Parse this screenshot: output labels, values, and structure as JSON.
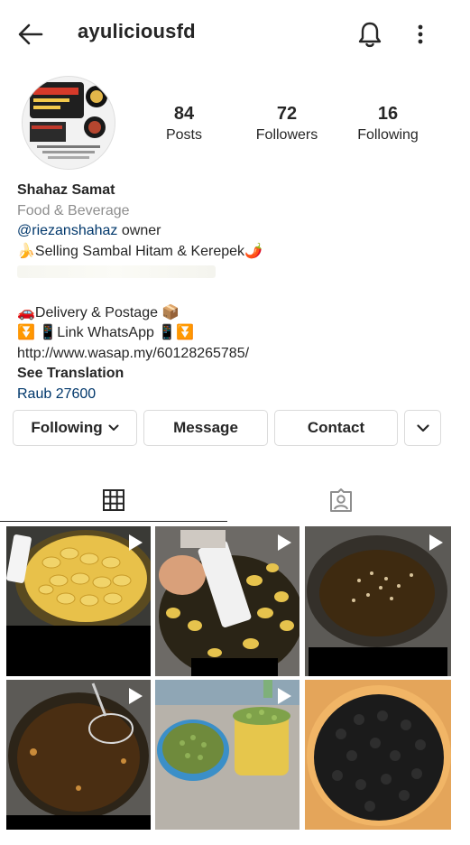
{
  "header": {
    "username": "ayuliciousfd"
  },
  "stats": [
    {
      "value": "84",
      "label": "Posts"
    },
    {
      "value": "72",
      "label": "Followers"
    },
    {
      "value": "16",
      "label": "Following"
    }
  ],
  "bio": {
    "name": "Shahaz Samat",
    "category": "Food & Beverage",
    "mention": "@riezanshahaz",
    "mention_suffix": " owner",
    "line_selling": "🍌Selling Sambal Hitam & Kerepek🌶️",
    "line_delivery": "🚗Delivery & Postage 📦",
    "line_whatsapp": "⏬ 📱Link WhatsApp 📱⏬",
    "link": "http://www.wasap.my/60128265785/",
    "see_translation": "See Translation",
    "location": "Raub 27600"
  },
  "buttons": {
    "following": "Following",
    "message": "Message",
    "contact": "Contact"
  },
  "colors": {
    "link_blue": "#00376b",
    "category_gray": "#8e8e8e",
    "border": "#dbdbdb"
  },
  "icons": {
    "back": "back-arrow-icon",
    "bell": "notification-bell-icon",
    "more": "more-vertical-icon",
    "grid": "grid-icon",
    "tagged": "tagged-person-icon",
    "chevron": "chevron-down-icon",
    "play": "video-play-icon"
  }
}
